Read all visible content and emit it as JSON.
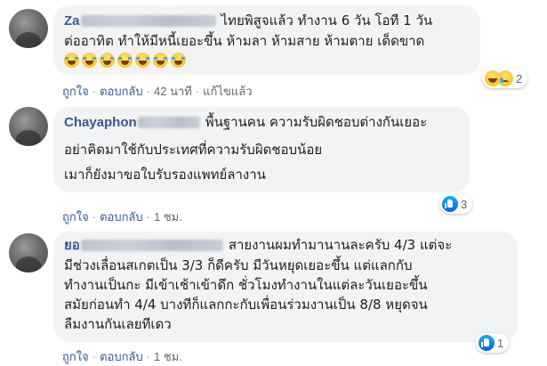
{
  "comments": [
    {
      "author_visible": "Za",
      "lines": [
        "ไทยพิสูจแล้ว ทำงาน 6 วัน โอที 1 วัน",
        "ต่ออาทิต ทำให้มีหนี้เยอะขึ้น ห้ามลา ห้ามสาย ห้ามตาย เด็ดขาด"
      ],
      "emoji_count": 7,
      "emoji_name": "rolling-on-floor-laughing-emoji",
      "actions": {
        "like": "ถูกใจ",
        "reply": "ตอบกลับ",
        "time": "42 นาที",
        "edited": "แก้ไขแล้ว"
      },
      "reactions": {
        "icons": [
          "haha-icon",
          "sad-icon"
        ],
        "count": "2"
      }
    },
    {
      "author_visible": "Chayaphon",
      "lines": [
        "พื้นฐานคน ความรับผิดชอบต่างกันเยอะ",
        "อย่าคิดมาใช้กับประเทศที่ความรับผิดชอบน้อย",
        "เมาก็ยังมาขอใบรับรองแพทย์ลางาน"
      ],
      "actions": {
        "like": "ถูกใจ",
        "reply": "ตอบกลับ",
        "time": "1 ชม."
      },
      "reactions": {
        "icons": [
          "like-icon"
        ],
        "count": "3"
      }
    },
    {
      "author_visible": "ยอ",
      "lines": [
        "สายงานผมทำมานานละครับ 4/3 แต่จะ",
        "มีช่วงเลื่อนสเกตเป็น 3/3 ก็ดีครับ มีวันหยุดเยอะขึ้น แต่แลกกับ",
        "ทำงานเป็นกะ มีเข้าเช้าเข้าดึก ชั่วโมงทำงานในแต่ละวันเยอะขึ้น",
        "สมัยก่อนทำ 4/4 บางทีก็แลกกะกับเพื่อนร่วมงานเป็น 8/8 หยุดจน",
        "ลืมงานกันเลยทีเดว"
      ],
      "actions": {
        "like": "ถูกใจ",
        "reply": "ตอบกลับ",
        "time": "1 ชม."
      },
      "reactions": {
        "icons": [
          "like-icon"
        ],
        "count": "1"
      }
    }
  ],
  "colors": {
    "author": "#385898",
    "bubble": "#f2f3f5",
    "meta": "#606770",
    "like_blue": "#0062df",
    "haha_yellow": "#f7b928"
  }
}
